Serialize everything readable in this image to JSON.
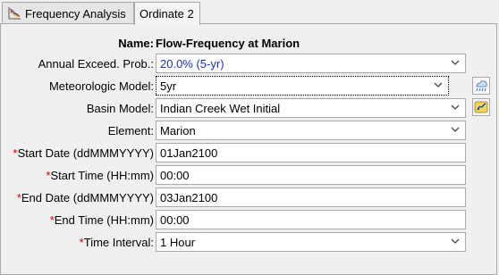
{
  "tabs": [
    {
      "label": "Frequency Analysis",
      "icon": "frequency-chart-icon",
      "active": false
    },
    {
      "label": "Ordinate 2",
      "active": true
    }
  ],
  "form": {
    "name_label": "Name:",
    "name_value": "Flow-Frequency at Marion",
    "aep_label": "Annual Exceed. Prob.:",
    "aep_value": "20.0% (5-yr)",
    "met_label": "Meteorologic Model:",
    "met_value": "5yr",
    "basin_label": "Basin Model:",
    "basin_value": "Indian Creek Wet Initial",
    "element_label": "Element:",
    "element_value": "Marion",
    "required_mark": "*",
    "start_date_label": "Start Date (ddMMMYYYY)",
    "start_date_value": "01Jan2100",
    "start_time_label": "Start Time (HH:mm)",
    "start_time_value": "00:00",
    "end_date_label": "End Date (ddMMMYYYY)",
    "end_date_value": "03Jan2100",
    "end_time_label": "End Time (HH:mm)",
    "end_time_value": "00:00",
    "interval_label": "Time Interval:",
    "interval_value": "1 Hour"
  },
  "colors": {
    "required": "#d00000",
    "aep_value_text": "#1a33c4"
  }
}
